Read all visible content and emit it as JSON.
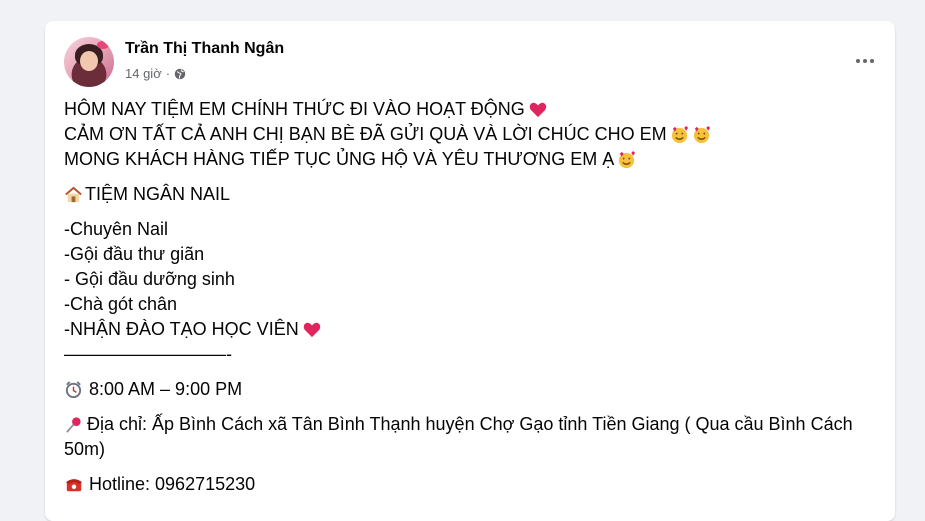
{
  "post": {
    "author": "Trần Thị Thanh Ngân",
    "time": "14 giờ",
    "separator": "·",
    "lines": {
      "l1": "HÔM NAY TIỆM EM CHÍNH THỨC ĐI VÀO HOẠT ĐỘNG",
      "l2": "CẢM ƠN TẤT CẢ ANH CHỊ BẠN BÈ ĐÃ GỬI QUÀ VÀ LỜI CHÚC CHO EM",
      "l3": "MONG KHÁCH  HÀNG TIẾP TỤC ỦNG HỘ VÀ YÊU THƯƠNG EM Ạ",
      "shop_name": "TIỆM NGÂN NAIL",
      "s1": "-Chuyên Nail",
      "s2": "-Gội đầu thư giãn",
      "s3": "- Gội đầu dưỡng sinh",
      "s4": "-Chà gót chân",
      "s5": "-NHẬN ĐÀO TẠO HỌC VIÊN",
      "divider": "—————————-",
      "hours": "8:00 AM – 9:00 PM",
      "address": "Địa chỉ: Ấp Bình Cách xã Tân Bình Thạnh huyện Chợ Gạo tỉnh Tiền Giang ( Qua cầu Bình Cách 50m)",
      "hotline": "Hotline: 0962715230"
    }
  },
  "icons": {
    "privacy": "globe-icon",
    "menu": "more-options-icon",
    "emoji_heart": "red-heart-icon",
    "emoji_smile": "smiling-face-with-hearts-icon",
    "emoji_house": "house-icon",
    "emoji_clock": "alarm-clock-icon",
    "emoji_pin": "pushpin-icon",
    "emoji_phone": "telephone-icon"
  },
  "colors": {
    "background": "#f0f2f5",
    "card": "#ffffff",
    "text": "#050505",
    "secondary_text": "#65676b",
    "heart": "#e0245e"
  }
}
